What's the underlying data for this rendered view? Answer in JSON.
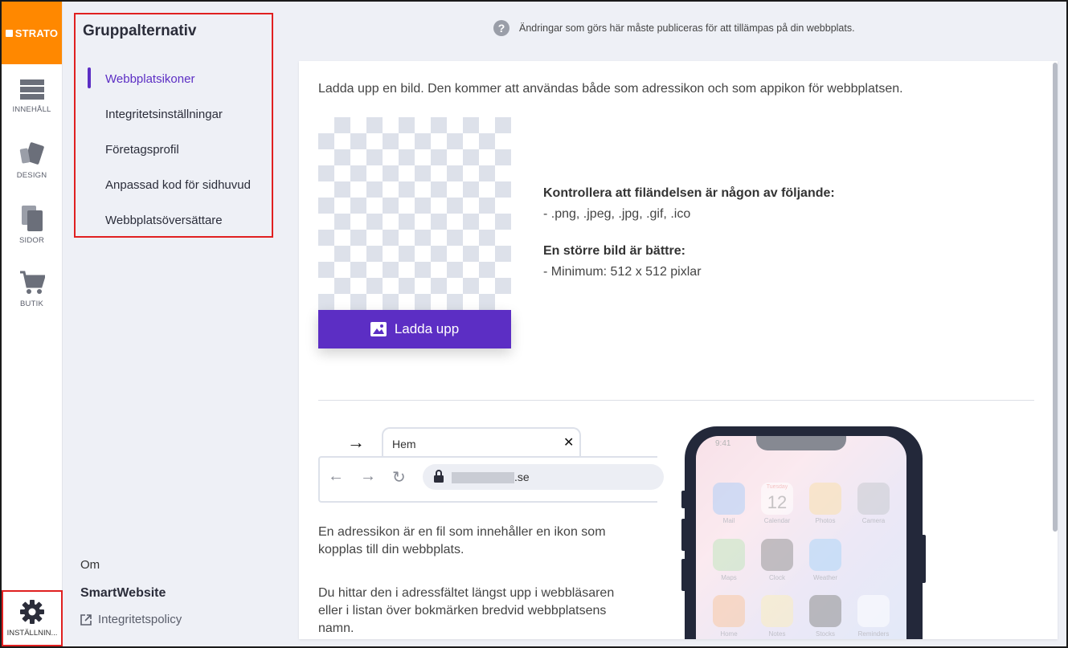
{
  "brand": {
    "logo_text": "STRATO",
    "accent": "#ff8800",
    "primary": "#5c2ec4"
  },
  "rail": {
    "items": [
      {
        "label": "INNEHÅLL",
        "icon": "content-icon"
      },
      {
        "label": "DESIGN",
        "icon": "design-icon"
      },
      {
        "label": "SIDOR",
        "icon": "pages-icon"
      },
      {
        "label": "BUTIK",
        "icon": "cart-icon"
      }
    ],
    "settings_label": "INSTÄLLNIN..."
  },
  "panel": {
    "title": "Gruppalternativ",
    "items": [
      {
        "label": "Webbplatsikoner",
        "active": true
      },
      {
        "label": "Integritetsinställningar"
      },
      {
        "label": "Företagsprofil"
      },
      {
        "label": "Anpassad kod för sidhuvud"
      },
      {
        "label": "Webbplatsöversättare"
      }
    ],
    "about_label": "Om",
    "product_name": "SmartWebsite",
    "privacy_link": "Integritetspolicy"
  },
  "notice": {
    "text": "Ändringar som görs här måste publiceras för att tillämpas på din webbplats."
  },
  "main": {
    "intro": "Ladda upp en bild. Den kommer att användas både som adressikon och som appikon för webbplatsen.",
    "upload_label": "Ladda upp",
    "check_title": "Kontrollera att filändelsen är någon av följande:",
    "check_value": "- .png, .jpeg, .jpg, .gif, .ico",
    "size_title": "En större bild är bättre:",
    "size_value": "- Minimum: 512 x 512 pixlar",
    "browser": {
      "tab_label": "Hem",
      "url_suffix": ".se"
    },
    "desc1_line1": "En adressikon är en fil som innehåller en ikon som",
    "desc1_line2": "kopplas till din webbplats.",
    "desc2_line1": "Du hittar den i adressfältet längst upp i webbläsaren",
    "desc2_line2": "eller i listan över bokmärken bredvid webbplatsens",
    "desc2_line3": "namn.",
    "phone": {
      "time": "9:41",
      "apps": [
        "Mail",
        "Calendar",
        "Photos",
        "Camera",
        "Maps",
        "Clock",
        "Weather",
        "Home",
        "Notes",
        "Stocks",
        "Reminders"
      ],
      "calendar_day": "Tuesday",
      "calendar_date": "12"
    }
  }
}
